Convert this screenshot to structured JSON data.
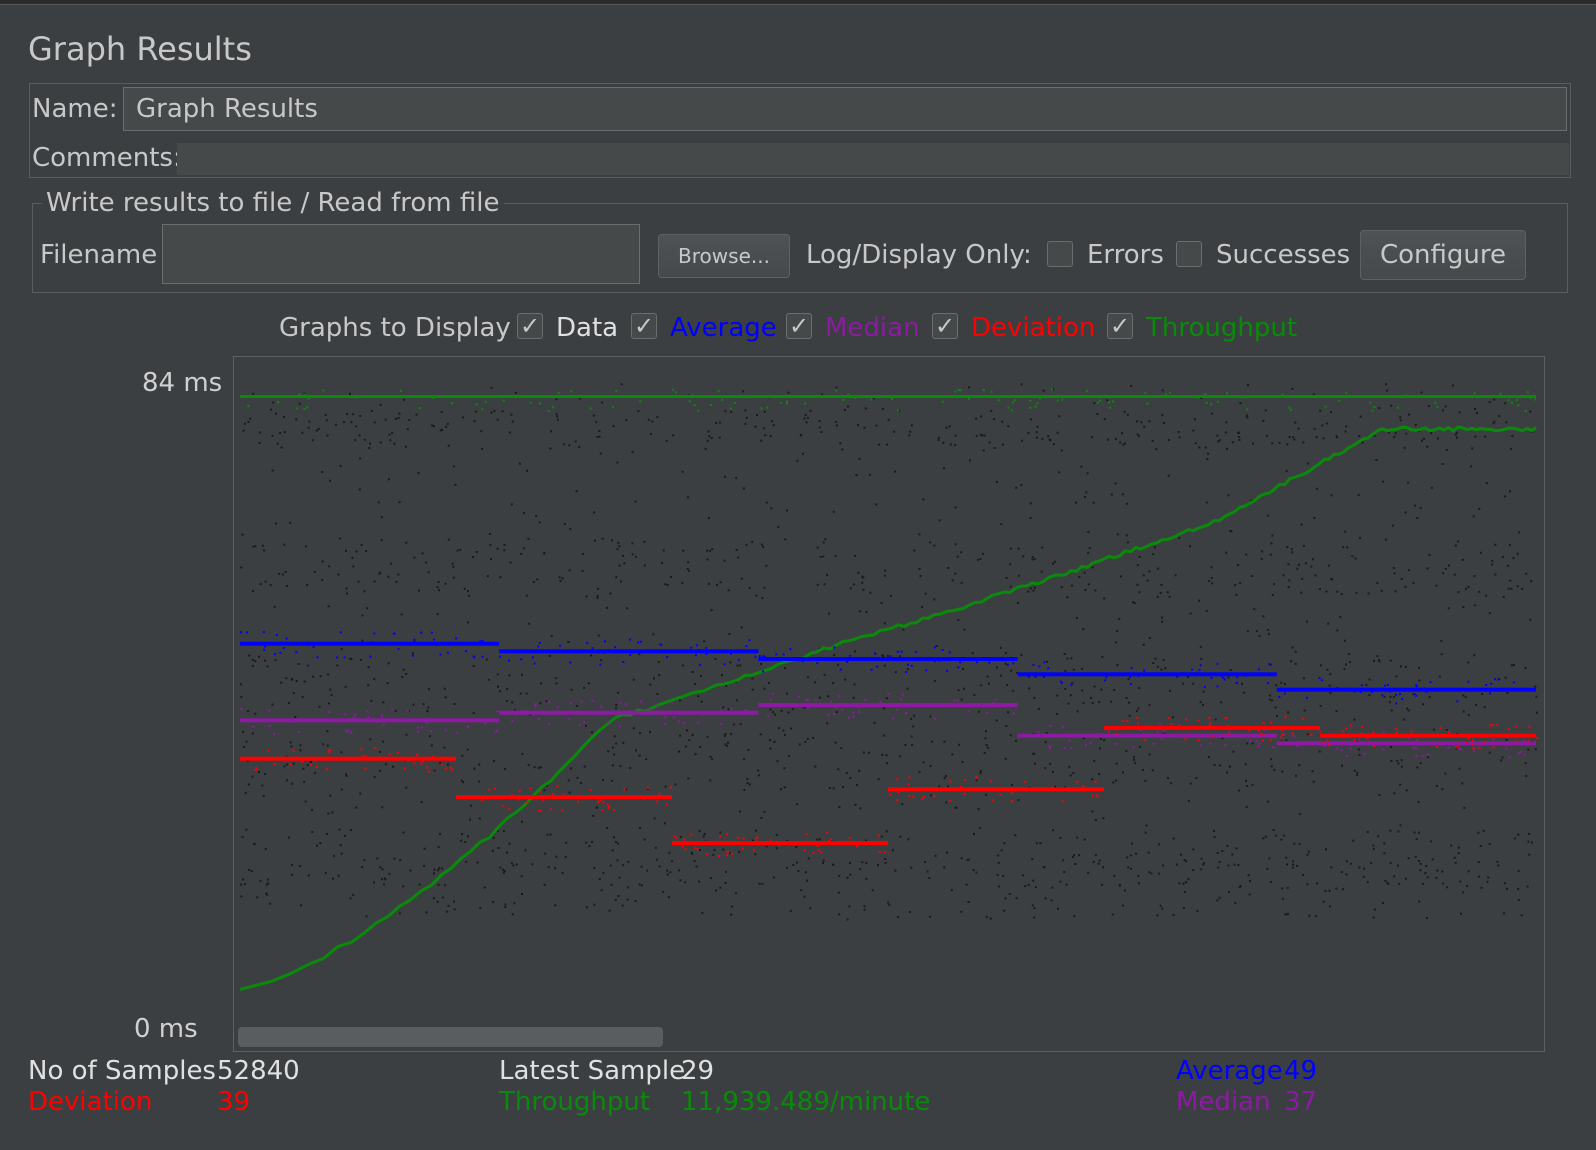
{
  "header": {
    "title": "Graph Results"
  },
  "form": {
    "name_label": "Name:",
    "name_value": "Graph Results",
    "comments_label": "Comments:",
    "comments_value": ""
  },
  "file_section": {
    "legend": "Write results to file / Read from file",
    "filename_label": "Filename",
    "filename_value": "",
    "browse_label": "Browse...",
    "log_display_label": "Log/Display Only:",
    "errors_label": "Errors",
    "errors_checked": false,
    "successes_label": "Successes",
    "successes_checked": false,
    "configure_label": "Configure"
  },
  "graphs_to_display": {
    "label": "Graphs to Display",
    "check_mark": "✓",
    "options": [
      {
        "label": "Data",
        "checked": true,
        "color": "#1a1a1a"
      },
      {
        "label": "Average",
        "checked": true,
        "color": "#0000ff"
      },
      {
        "label": "Median",
        "checked": true,
        "color": "#8c1aa3"
      },
      {
        "label": "Deviation",
        "checked": true,
        "color": "#ff0000"
      },
      {
        "label": "Throughput",
        "checked": true,
        "color": "#0a8a0a"
      }
    ]
  },
  "axis": {
    "max_label": "84  ms",
    "min_label": "0  ms"
  },
  "chart_data": {
    "type": "scatter",
    "ylim": [
      0,
      84
    ],
    "y_unit": "ms",
    "grid": false,
    "series": [
      {
        "name": "Data",
        "color": "#1a1a1a",
        "y_levels": [
          22,
          78,
          45,
          60,
          18,
          35
        ]
      },
      {
        "name": "Average",
        "color": "#0000ff",
        "y_levels": [
          50,
          49,
          48,
          46,
          44
        ]
      },
      {
        "name": "Median",
        "color": "#8c1aa3",
        "y_levels": [
          40,
          41,
          42,
          38,
          37
        ]
      },
      {
        "name": "Deviation",
        "color": "#ff0000",
        "y_levels": [
          35,
          30,
          24,
          31,
          39,
          38
        ]
      },
      {
        "name": "Throughput",
        "color": "#0a8a0a",
        "y_levels": [
          5,
          40,
          50,
          58,
          66,
          78,
          84
        ]
      }
    ]
  },
  "stats": {
    "samples_label": "No of Samples",
    "samples_value": "52840",
    "latest_label": "Latest Sample",
    "latest_value": "29",
    "average_label": "Average",
    "average_value": "49",
    "deviation_label": "Deviation",
    "deviation_value": "39",
    "throughput_label": "Throughput",
    "throughput_value": "11,939.489/minute",
    "median_label": "Median",
    "median_value": "37"
  }
}
